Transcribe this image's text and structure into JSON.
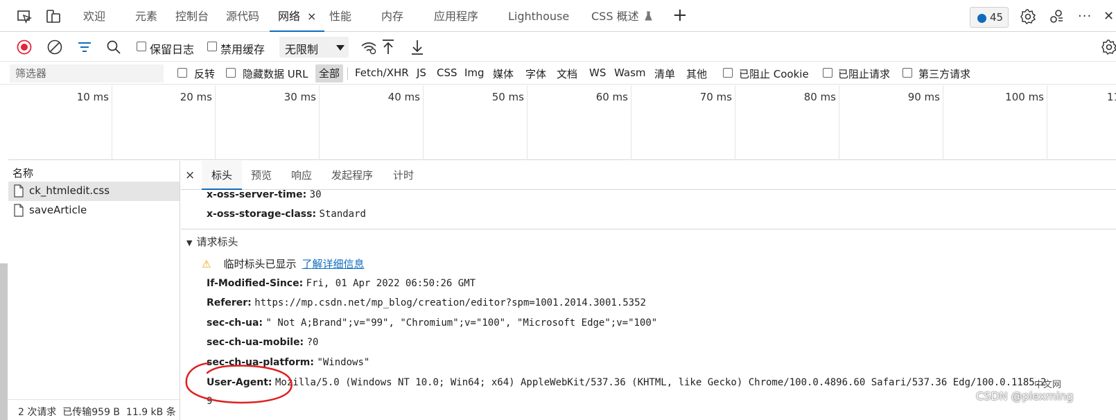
{
  "tabs": [
    {
      "label": "欢迎"
    },
    {
      "label": "元素"
    },
    {
      "label": "控制台"
    },
    {
      "label": "源代码"
    },
    {
      "label": "网络",
      "close": "×"
    },
    {
      "label": "性能"
    },
    {
      "label": "内存"
    },
    {
      "label": "应用程序"
    },
    {
      "label": "Lighthouse"
    },
    {
      "label": "CSS 概述"
    }
  ],
  "tabbar": {
    "add": "+",
    "more": "···",
    "close": "✕",
    "message_count": "45"
  },
  "toolbar": {
    "preserve_log": "保留日志",
    "disable_cache": "禁用缓存",
    "throttle_value": "无限制"
  },
  "filter": {
    "placeholder": "筛选器",
    "invert": "反转",
    "hide_data_urls": "隐藏数据 URL",
    "types": [
      "全部",
      "Fetch/XHR",
      "JS",
      "CSS",
      "Img",
      "媒体",
      "字体",
      "文档",
      "WS",
      "Wasm",
      "清单",
      "其他"
    ],
    "blocked_cookies": "已阻止 Cookie",
    "blocked_requests": "已阻止请求",
    "third_party": "第三方请求"
  },
  "timeline": {
    "ticks": [
      "10 ms",
      "20 ms",
      "30 ms",
      "40 ms",
      "50 ms",
      "60 ms",
      "70 ms",
      "80 ms",
      "90 ms",
      "100 ms",
      "11"
    ]
  },
  "requests": {
    "header": "名称",
    "items": [
      "ck_htmledit.css",
      "saveArticle"
    ],
    "status": "2 次请求  已传输959 B  11.9 kB 条"
  },
  "detail": {
    "close": "×",
    "tabs": [
      "标头",
      "预览",
      "响应",
      "发起程序",
      "计时"
    ],
    "response_headers": [
      {
        "key": "x-oss-server-time:",
        "value": "30"
      },
      {
        "key": "x-oss-storage-class:",
        "value": "Standard"
      }
    ],
    "section_title": "请求标头",
    "warning": {
      "icon": "⚠",
      "text": "临时标头已显示",
      "link": "了解详细信息"
    },
    "request_headers": [
      {
        "key": "If-Modified-Since:",
        "value": "Fri, 01 Apr 2022 06:50:26 GMT"
      },
      {
        "key": "Referer:",
        "value": "https://mp.csdn.net/mp_blog/creation/editor?spm=1001.2014.3001.5352"
      },
      {
        "key": "sec-ch-ua:",
        "value": "\" Not A;Brand\";v=\"99\", \"Chromium\";v=\"100\", \"Microsoft Edge\";v=\"100\""
      },
      {
        "key": "sec-ch-ua-mobile:",
        "value": "?0"
      },
      {
        "key": "sec-ch-ua-platform:",
        "value": "\"Windows\""
      },
      {
        "key": "User-Agent:",
        "value": "Mozilla/5.0 (Windows NT 10.0; Win64; x64) AppleWebKit/537.36 (KHTML, like Gecko) Chrome/100.0.4896.60 Safari/537.36 Edg/100.0.1185.2"
      },
      {
        "key": "",
        "value": "9"
      }
    ]
  },
  "watermark": {
    "text": "CSDN @plexming",
    "badge": "中文网"
  },
  "colors": {
    "accent": "#0f6cbd",
    "record": "#e0263c",
    "annotation": "#e02020"
  }
}
